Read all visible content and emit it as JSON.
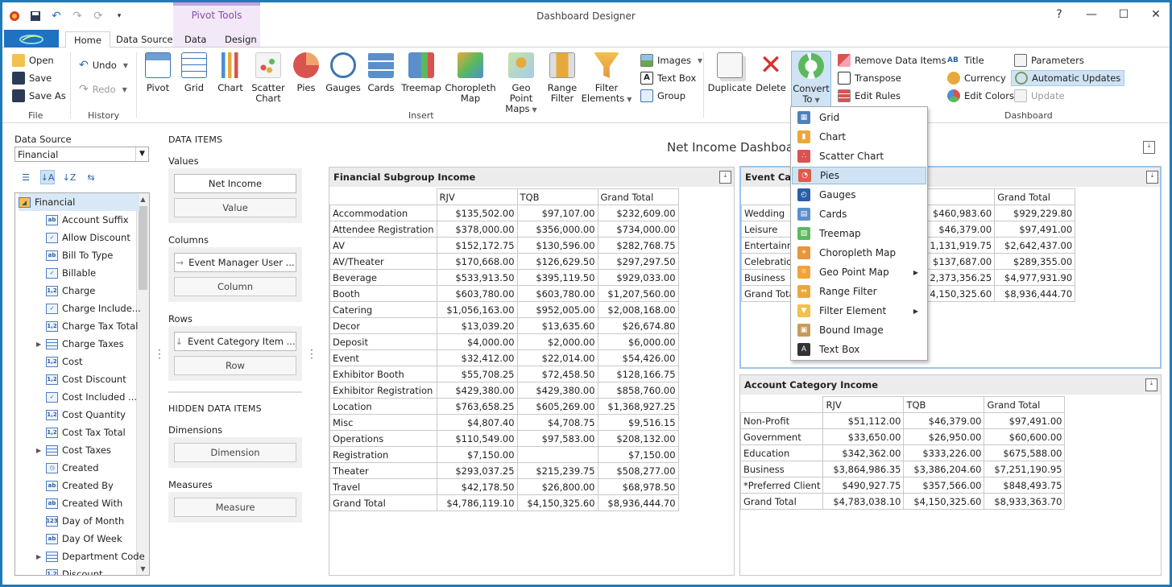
{
  "app_title": "Dashboard Designer",
  "pivot_tools_label": "Pivot Tools",
  "tabs": [
    "Home",
    "Data Source",
    "Data",
    "Design"
  ],
  "ribbon": {
    "file": {
      "open": "Open",
      "save": "Save",
      "save_as": "Save As",
      "label": "File"
    },
    "history": {
      "undo": "Undo",
      "redo": "Redo",
      "label": "History"
    },
    "insert": {
      "label": "Insert",
      "buttons": [
        {
          "l1": "Pivot",
          "l2": ""
        },
        {
          "l1": "Grid",
          "l2": ""
        },
        {
          "l1": "Chart",
          "l2": ""
        },
        {
          "l1": "Scatter",
          "l2": "Chart"
        },
        {
          "l1": "Pies",
          "l2": ""
        },
        {
          "l1": "Gauges",
          "l2": ""
        },
        {
          "l1": "Cards",
          "l2": ""
        },
        {
          "l1": "Treemap",
          "l2": ""
        },
        {
          "l1": "Choropleth",
          "l2": "Map"
        },
        {
          "l1": "Geo Point",
          "l2": "Maps"
        },
        {
          "l1": "Range",
          "l2": "Filter"
        },
        {
          "l1": "Filter",
          "l2": "Elements"
        }
      ],
      "images": "Images",
      "text_box": "Text Box",
      "group": "Group"
    },
    "item": {
      "duplicate": "Duplicate",
      "delete": "Delete",
      "convert_l1": "Convert",
      "convert_l2": "To",
      "remove_data_items": "Remove Data Items",
      "transpose": "Transpose",
      "edit_rules": "Edit Rules"
    },
    "dashboard": {
      "title": "Title",
      "currency": "Currency",
      "edit_colors": "Edit Colors",
      "parameters": "Parameters",
      "automatic_updates": "Automatic Updates",
      "update": "Update",
      "label": "Dashboard"
    }
  },
  "data_source": {
    "label": "Data Source",
    "selected": "Financial",
    "tree": [
      "Financial",
      "Account Suffix",
      "Allow Discount",
      "Bill To Type",
      "Billable",
      "Charge",
      "Charge Include...",
      "Charge Tax Total",
      "Charge Taxes",
      "Cost",
      "Cost Discount",
      "Cost Included ...",
      "Cost Quantity",
      "Cost Tax Total",
      "Cost Taxes",
      "Created",
      "Created By",
      "Created With",
      "Day of Month",
      "Day Of Week",
      "Department Code",
      "Discount"
    ],
    "icon_types": [
      "db",
      "ab",
      "chk",
      "ab",
      "chk",
      "12",
      "chk",
      "12",
      "grid",
      "12",
      "12",
      "chk",
      "12",
      "12",
      "grid",
      "clk",
      "ab",
      "ab",
      "123",
      "ab",
      "grid",
      "12"
    ]
  },
  "data_items": {
    "title": "DATA ITEMS",
    "values_label": "Values",
    "values_item": "Net Income",
    "values_ghost": "Value",
    "columns_label": "Columns",
    "columns_item": "Event Manager User ...",
    "columns_ghost": "Column",
    "rows_label": "Rows",
    "rows_item": "Event Category Item ...",
    "rows_ghost": "Row",
    "hidden_title": "HIDDEN DATA ITEMS",
    "dimensions_label": "Dimensions",
    "dimensions_ghost": "Dimension",
    "measures_label": "Measures",
    "measures_ghost": "Measure"
  },
  "dashboard": {
    "title": "Net Income Dashboard",
    "panels": {
      "subgroup": {
        "caption": "Financial Subgroup Income",
        "headers": [
          "",
          "RJV",
          "TQB",
          "Grand Total"
        ],
        "rows": [
          [
            "Accommodation",
            "$135,502.00",
            "$97,107.00",
            "$232,609.00"
          ],
          [
            "Attendee Registration",
            "$378,000.00",
            "$356,000.00",
            "$734,000.00"
          ],
          [
            "AV",
            "$152,172.75",
            "$130,596.00",
            "$282,768.75"
          ],
          [
            "AV/Theater",
            "$170,668.00",
            "$126,629.50",
            "$297,297.50"
          ],
          [
            "Beverage",
            "$533,913.50",
            "$395,119.50",
            "$929,033.00"
          ],
          [
            "Booth",
            "$603,780.00",
            "$603,780.00",
            "$1,207,560.00"
          ],
          [
            "Catering",
            "$1,056,163.00",
            "$952,005.00",
            "$2,008,168.00"
          ],
          [
            "Decor",
            "$13,039.20",
            "$13,635.60",
            "$26,674.80"
          ],
          [
            "Deposit",
            "$4,000.00",
            "$2,000.00",
            "$6,000.00"
          ],
          [
            "Event",
            "$32,412.00",
            "$22,014.00",
            "$54,426.00"
          ],
          [
            "Exhibitor Booth",
            "$55,708.25",
            "$72,458.50",
            "$128,166.75"
          ],
          [
            "Exhibitor Registration",
            "$429,380.00",
            "$429,380.00",
            "$858,760.00"
          ],
          [
            "Location",
            "$763,658.25",
            "$605,269.00",
            "$1,368,927.25"
          ],
          [
            "Misc",
            "$4,807.40",
            "$4,708.75",
            "$9,516.15"
          ],
          [
            "Operations",
            "$110,549.00",
            "$97,583.00",
            "$208,132.00"
          ],
          [
            "Registration",
            "$7,150.00",
            "",
            "$7,150.00"
          ],
          [
            "Theater",
            "$293,037.25",
            "$215,239.75",
            "$508,277.00"
          ],
          [
            "Travel",
            "$42,178.50",
            "$26,800.00",
            "$68,978.50"
          ],
          [
            "Grand Total",
            "$4,786,119.10",
            "$4,150,325.60",
            "$8,936,444.70"
          ]
        ]
      },
      "event_category": {
        "caption": "Event Cate",
        "headers": [
          "",
          "",
          "Grand Total"
        ],
        "rows": [
          [
            "Wedding",
            "$460,983.60",
            "$929,229.80"
          ],
          [
            "Leisure",
            "$46,379.00",
            "$97,491.00"
          ],
          [
            "Entertainme",
            "1,131,919.75",
            "$2,642,437.00"
          ],
          [
            "Celebration",
            "$137,687.00",
            "$289,355.00"
          ],
          [
            "Business",
            "2,373,356.25",
            "$4,977,931.90"
          ],
          [
            "Grand Total",
            "4,150,325.60",
            "$8,936,444.70"
          ]
        ]
      },
      "account_category": {
        "caption": "Account Category Income",
        "headers": [
          "",
          "RJV",
          "TQB",
          "Grand Total"
        ],
        "rows": [
          [
            "Non-Profit",
            "$51,112.00",
            "$46,379.00",
            "$97,491.00"
          ],
          [
            "Government",
            "$33,650.00",
            "$26,950.00",
            "$60,600.00"
          ],
          [
            "Education",
            "$342,362.00",
            "$333,226.00",
            "$675,588.00"
          ],
          [
            "Business",
            "$3,864,986.35",
            "$3,386,204.60",
            "$7,251,190.95"
          ],
          [
            "*Preferred Client",
            "$490,927.75",
            "$357,566.00",
            "$848,493.75"
          ],
          [
            "Grand Total",
            "$4,783,038.10",
            "$4,150,325.60",
            "$8,933,363.70"
          ]
        ]
      }
    }
  },
  "convert_menu": {
    "items": [
      "Grid",
      "Chart",
      "Scatter Chart",
      "Pies",
      "Gauges",
      "Cards",
      "Treemap",
      "Choropleth Map",
      "Geo Point Map",
      "Range Filter",
      "Filter Element",
      "Bound Image",
      "Text Box"
    ],
    "highlighted": "Pies",
    "submenu_items": [
      "Geo Point Map",
      "Filter Element"
    ]
  },
  "colors": {
    "accent": "#1e7bb8",
    "file_tab": "#1e72c0",
    "highlight": "#cfe3f5",
    "pivot_tools": "#8a4da5"
  }
}
